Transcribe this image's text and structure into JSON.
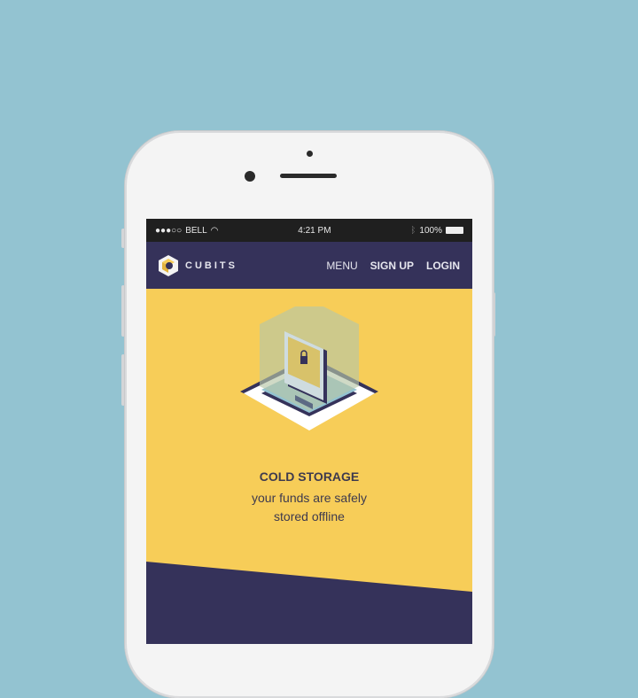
{
  "status_bar": {
    "carrier": "BELL",
    "time": "4:21 PM",
    "battery": "100%"
  },
  "nav": {
    "brand": "CUBITS",
    "menu": "MENU",
    "sign_up": "SIGN UP",
    "login": "LOGIN"
  },
  "hero": {
    "title": "COLD STORAGE",
    "subtitle_line1": "your funds are safely",
    "subtitle_line2": "stored offline"
  },
  "colors": {
    "background": "#93c3d1",
    "nav": "#35325a",
    "hero": "#f7cd58"
  }
}
